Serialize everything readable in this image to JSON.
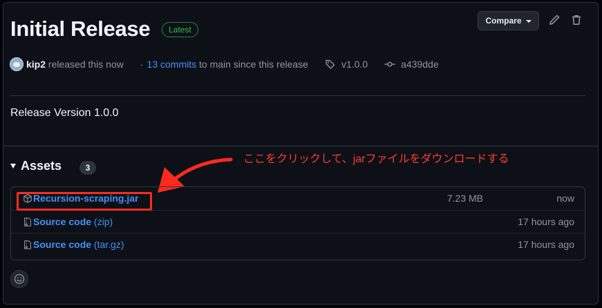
{
  "release": {
    "title": "Initial Release",
    "badge": "Latest",
    "compare_label": "Compare",
    "author": "kip2",
    "released_text": "released this now",
    "commits_link": "13 commits",
    "commits_suffix": "to main since this release",
    "tag": "v1.0.0",
    "commit_sha": "a439dde",
    "body": "Release Version 1.0.0"
  },
  "assets": {
    "heading": "Assets",
    "count": "3",
    "items": [
      {
        "name": "Recursion-scraping.jar",
        "suffix": "",
        "size": "7.23 MB",
        "date": "now",
        "icon": "package-icon"
      },
      {
        "name": "Source code",
        "suffix": "(zip)",
        "size": "",
        "date": "17 hours ago",
        "icon": "file-zip-icon"
      },
      {
        "name": "Source code",
        "suffix": "(tar.gz)",
        "size": "",
        "date": "17 hours ago",
        "icon": "file-zip-icon"
      }
    ]
  },
  "annotation": {
    "text": "ここをクリックして、jarファイルをダウンロードする",
    "color": "#ff3b30"
  },
  "colors": {
    "background": "#0d1117",
    "link": "#4493f8",
    "badge_green": "#3fb950",
    "highlight_red": "#ff2a1f"
  }
}
